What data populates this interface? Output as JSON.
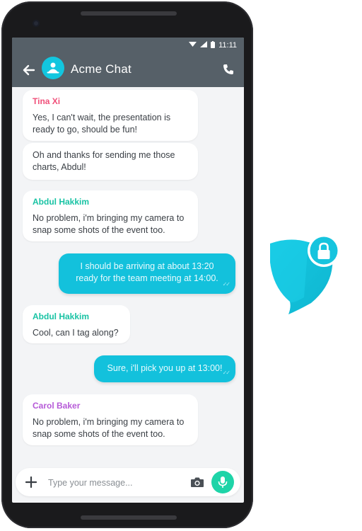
{
  "status_bar": {
    "time": "11:11"
  },
  "chat": {
    "title": "Acme Chat"
  },
  "messages": [
    {
      "direction": "in",
      "sender": "Tina Xi",
      "sender_color": "#f0507a",
      "text": "Yes, I can't wait, the presentation is ready to go, should be fun!"
    },
    {
      "direction": "in",
      "sender": "",
      "text": "Oh and thanks for sending me those charts, Abdul!"
    },
    {
      "direction": "in",
      "sender": "Abdul Hakkim",
      "sender_color": "#19c3a4",
      "text": "No problem, i'm bringing my camera to snap some shots of the event too."
    },
    {
      "direction": "out",
      "text": "I should be arriving at about 13:20 ready for the team meeting at 14:00."
    },
    {
      "direction": "in",
      "sender": "Abdul Hakkim",
      "sender_color": "#19c3a4",
      "text": "Cool, can I tag along?"
    },
    {
      "direction": "out",
      "text": "Sure, i'll pick you up at 13:00!"
    },
    {
      "direction": "in",
      "sender": "Carol Baker",
      "sender_color": "#b65ad8",
      "text": "No problem, i'm bringing my camera to snap some shots of the event too."
    }
  ],
  "composer": {
    "placeholder": "Type your message...",
    "value": ""
  },
  "icons": {
    "back": "arrow-left-icon",
    "call": "phone-icon",
    "avatar": "group-icon",
    "add": "plus-icon",
    "camera": "camera-icon",
    "mic": "microphone-icon",
    "shield": "shield-lock-icon"
  },
  "colors": {
    "toolbar": "#566068",
    "accent": "#13c1dc",
    "mic": "#1ed4a8"
  }
}
